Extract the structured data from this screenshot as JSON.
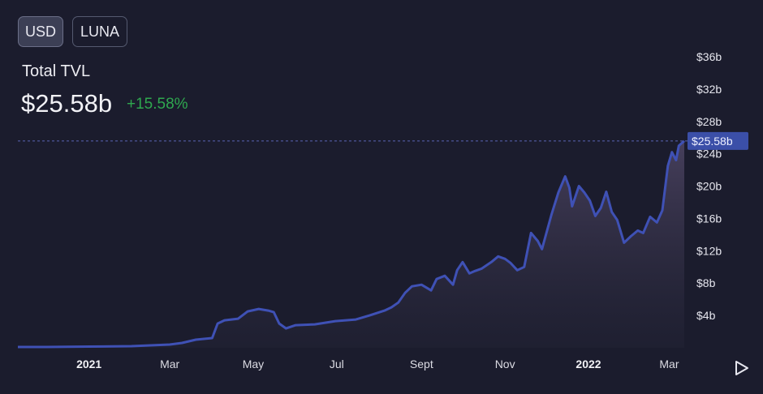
{
  "currency_toggle": {
    "usd_label": "USD",
    "luna_label": "LUNA"
  },
  "header": {
    "title": "Total TVL",
    "value": "$25.58b",
    "change": "+15.58%"
  },
  "colors": {
    "background": "#1b1c2d",
    "line": "#3f51b5",
    "positive": "#2fa84f",
    "price_tag": "#3b4fa8"
  },
  "icons": {
    "play": "play-icon"
  },
  "chart_data": {
    "type": "area",
    "title": "Total TVL",
    "xlabel": "",
    "ylabel": "",
    "x_range": [
      "2020-11-10",
      "2022-03-12"
    ],
    "ylim": [
      0,
      37
    ],
    "y_ticks": [
      {
        "value": 4,
        "label": "$4b"
      },
      {
        "value": 8,
        "label": "$8b"
      },
      {
        "value": 12,
        "label": "$12b"
      },
      {
        "value": 16,
        "label": "$16b"
      },
      {
        "value": 20,
        "label": "$20b"
      },
      {
        "value": 24,
        "label": "$24b"
      },
      {
        "value": 28,
        "label": "$28b"
      },
      {
        "value": 32,
        "label": "$32b"
      },
      {
        "value": 36,
        "label": "$36b"
      }
    ],
    "x_ticks": [
      {
        "date": "2021-01-01",
        "label": "2021",
        "bold": true
      },
      {
        "date": "2021-03-01",
        "label": "Mar",
        "bold": false
      },
      {
        "date": "2021-05-01",
        "label": "May",
        "bold": false
      },
      {
        "date": "2021-07-01",
        "label": "Jul",
        "bold": false
      },
      {
        "date": "2021-09-01",
        "label": "Sept",
        "bold": false
      },
      {
        "date": "2021-11-01",
        "label": "Nov",
        "bold": false
      },
      {
        "date": "2022-01-01",
        "label": "2022",
        "bold": true
      },
      {
        "date": "2022-03-01",
        "label": "Mar",
        "bold": false
      }
    ],
    "current": {
      "value": 25.58,
      "label": "$25.58b"
    },
    "grid": false,
    "series": [
      {
        "points": [
          [
            "2020-11-10",
            0.1
          ],
          [
            "2020-12-01",
            0.1
          ],
          [
            "2021-01-01",
            0.15
          ],
          [
            "2021-02-01",
            0.2
          ],
          [
            "2021-03-01",
            0.4
          ],
          [
            "2021-03-10",
            0.6
          ],
          [
            "2021-03-20",
            1.0
          ],
          [
            "2021-04-01",
            1.2
          ],
          [
            "2021-04-05",
            3.0
          ],
          [
            "2021-04-10",
            3.4
          ],
          [
            "2021-04-20",
            3.6
          ],
          [
            "2021-04-27",
            4.5
          ],
          [
            "2021-05-05",
            4.8
          ],
          [
            "2021-05-12",
            4.6
          ],
          [
            "2021-05-16",
            4.4
          ],
          [
            "2021-05-20",
            3.0
          ],
          [
            "2021-05-25",
            2.4
          ],
          [
            "2021-06-01",
            2.8
          ],
          [
            "2021-06-15",
            2.9
          ],
          [
            "2021-06-30",
            3.3
          ],
          [
            "2021-07-15",
            3.5
          ],
          [
            "2021-07-25",
            4.0
          ],
          [
            "2021-08-05",
            4.6
          ],
          [
            "2021-08-10",
            5.0
          ],
          [
            "2021-08-15",
            5.6
          ],
          [
            "2021-08-20",
            6.8
          ],
          [
            "2021-08-25",
            7.6
          ],
          [
            "2021-09-01",
            7.8
          ],
          [
            "2021-09-08",
            7.1
          ],
          [
            "2021-09-12",
            8.5
          ],
          [
            "2021-09-18",
            8.9
          ],
          [
            "2021-09-24",
            7.8
          ],
          [
            "2021-09-27",
            9.6
          ],
          [
            "2021-10-01",
            10.6
          ],
          [
            "2021-10-06",
            9.2
          ],
          [
            "2021-10-10",
            9.5
          ],
          [
            "2021-10-15",
            9.8
          ],
          [
            "2021-10-22",
            10.6
          ],
          [
            "2021-10-27",
            11.3
          ],
          [
            "2021-11-01",
            11.0
          ],
          [
            "2021-11-05",
            10.5
          ],
          [
            "2021-11-10",
            9.6
          ],
          [
            "2021-11-15",
            10.0
          ],
          [
            "2021-11-20",
            14.2
          ],
          [
            "2021-11-25",
            13.2
          ],
          [
            "2021-11-28",
            12.2
          ],
          [
            "2021-12-05",
            16.5
          ],
          [
            "2021-12-10",
            19.2
          ],
          [
            "2021-12-15",
            21.2
          ],
          [
            "2021-12-18",
            19.8
          ],
          [
            "2021-12-20",
            17.5
          ],
          [
            "2021-12-25",
            20.0
          ],
          [
            "2021-12-29",
            19.2
          ],
          [
            "2022-01-02",
            18.2
          ],
          [
            "2022-01-06",
            16.3
          ],
          [
            "2022-01-10",
            17.3
          ],
          [
            "2022-01-14",
            19.3
          ],
          [
            "2022-01-18",
            16.8
          ],
          [
            "2022-01-22",
            15.8
          ],
          [
            "2022-01-27",
            13.0
          ],
          [
            "2022-02-01",
            13.8
          ],
          [
            "2022-02-06",
            14.5
          ],
          [
            "2022-02-10",
            14.2
          ],
          [
            "2022-02-15",
            16.2
          ],
          [
            "2022-02-20",
            15.5
          ],
          [
            "2022-02-24",
            17.0
          ],
          [
            "2022-02-28",
            22.5
          ],
          [
            "2022-03-03",
            24.2
          ],
          [
            "2022-03-06",
            23.2
          ],
          [
            "2022-03-08",
            25.0
          ],
          [
            "2022-03-12",
            25.58
          ]
        ]
      }
    ]
  }
}
